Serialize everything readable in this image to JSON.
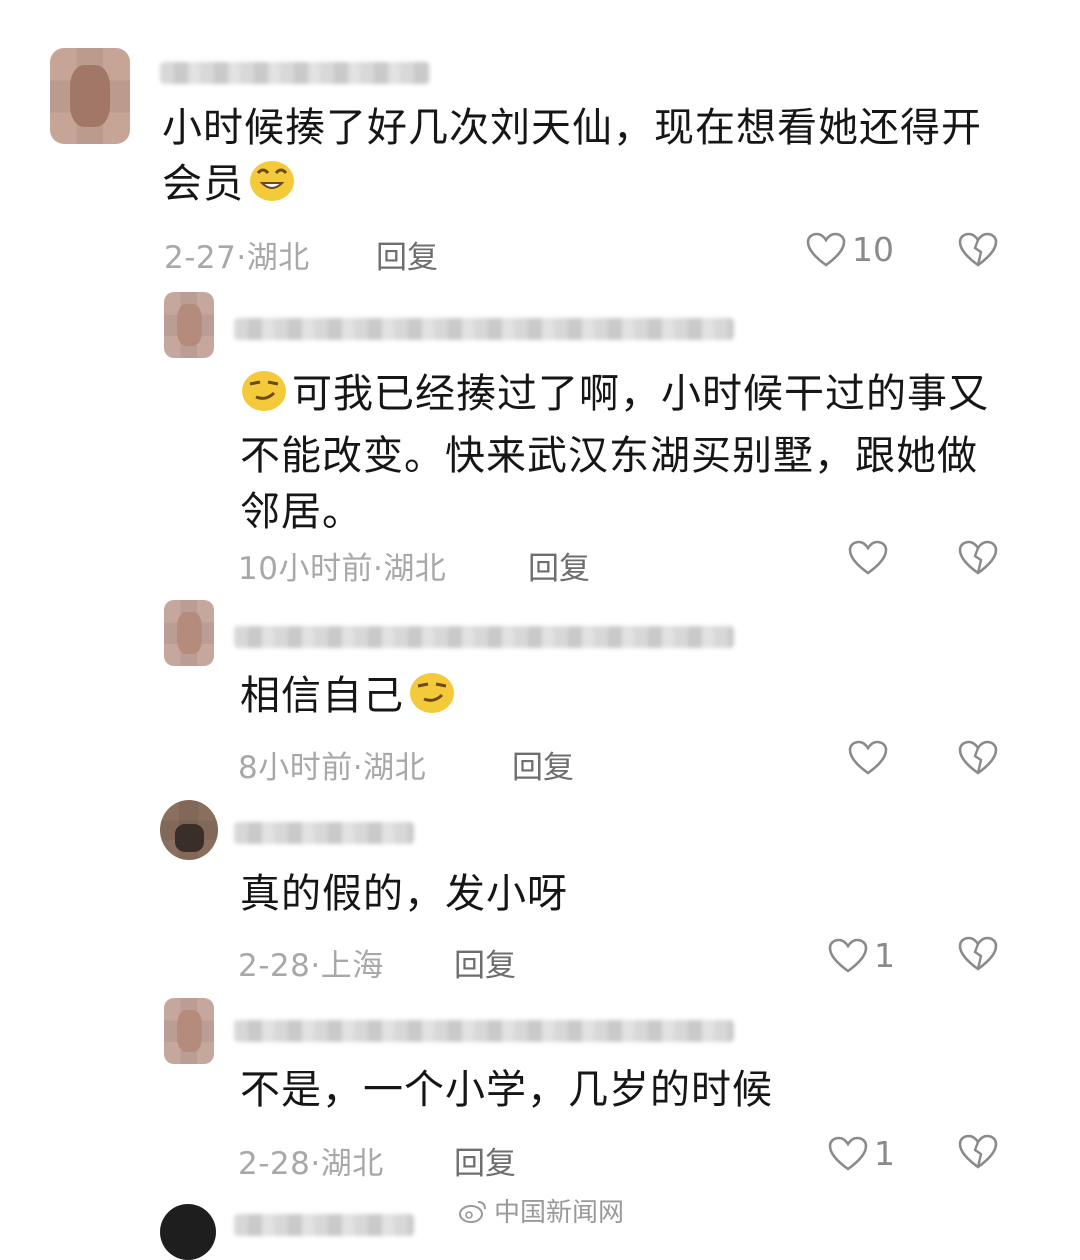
{
  "comments": [
    {
      "text_line1": "小时候揍了好几次刘天仙，现在想看她还得开",
      "text_line2": "会员",
      "time": "2-27",
      "location": "湖北",
      "reply_label": "回复",
      "likes": "10"
    },
    {
      "text_line1": "可我已经揍过了啊，小时候干过的事又",
      "text_line2": "不能改变。快来武汉东湖买别墅，跟她做",
      "text_line3": "邻居。",
      "time": "10小时前",
      "location": "湖北",
      "reply_label": "回复",
      "likes": ""
    },
    {
      "text_line1": "相信自己",
      "time": "8小时前",
      "location": "湖北",
      "reply_label": "回复",
      "likes": ""
    },
    {
      "text_line1": "真的假的，发小呀",
      "time": "2-28",
      "location": "上海",
      "reply_label": "回复",
      "likes": "1"
    },
    {
      "text_line1": "不是，一个小学，几岁的时候",
      "time": "2-28",
      "location": "湖北",
      "reply_label": "回复",
      "likes": "1"
    }
  ],
  "meta_separator": "·",
  "watermark": "中国新闻网",
  "colors": {
    "text": "#161616",
    "meta": "#a8a8a8",
    "reply": "#6e6e6e",
    "icon": "#8a8a8a",
    "emoji": "#f4c93a"
  },
  "icons": [
    "heart-icon",
    "dislike-heart-icon",
    "grinning-emoji",
    "smirk-emoji",
    "weibo-logo-icon"
  ]
}
